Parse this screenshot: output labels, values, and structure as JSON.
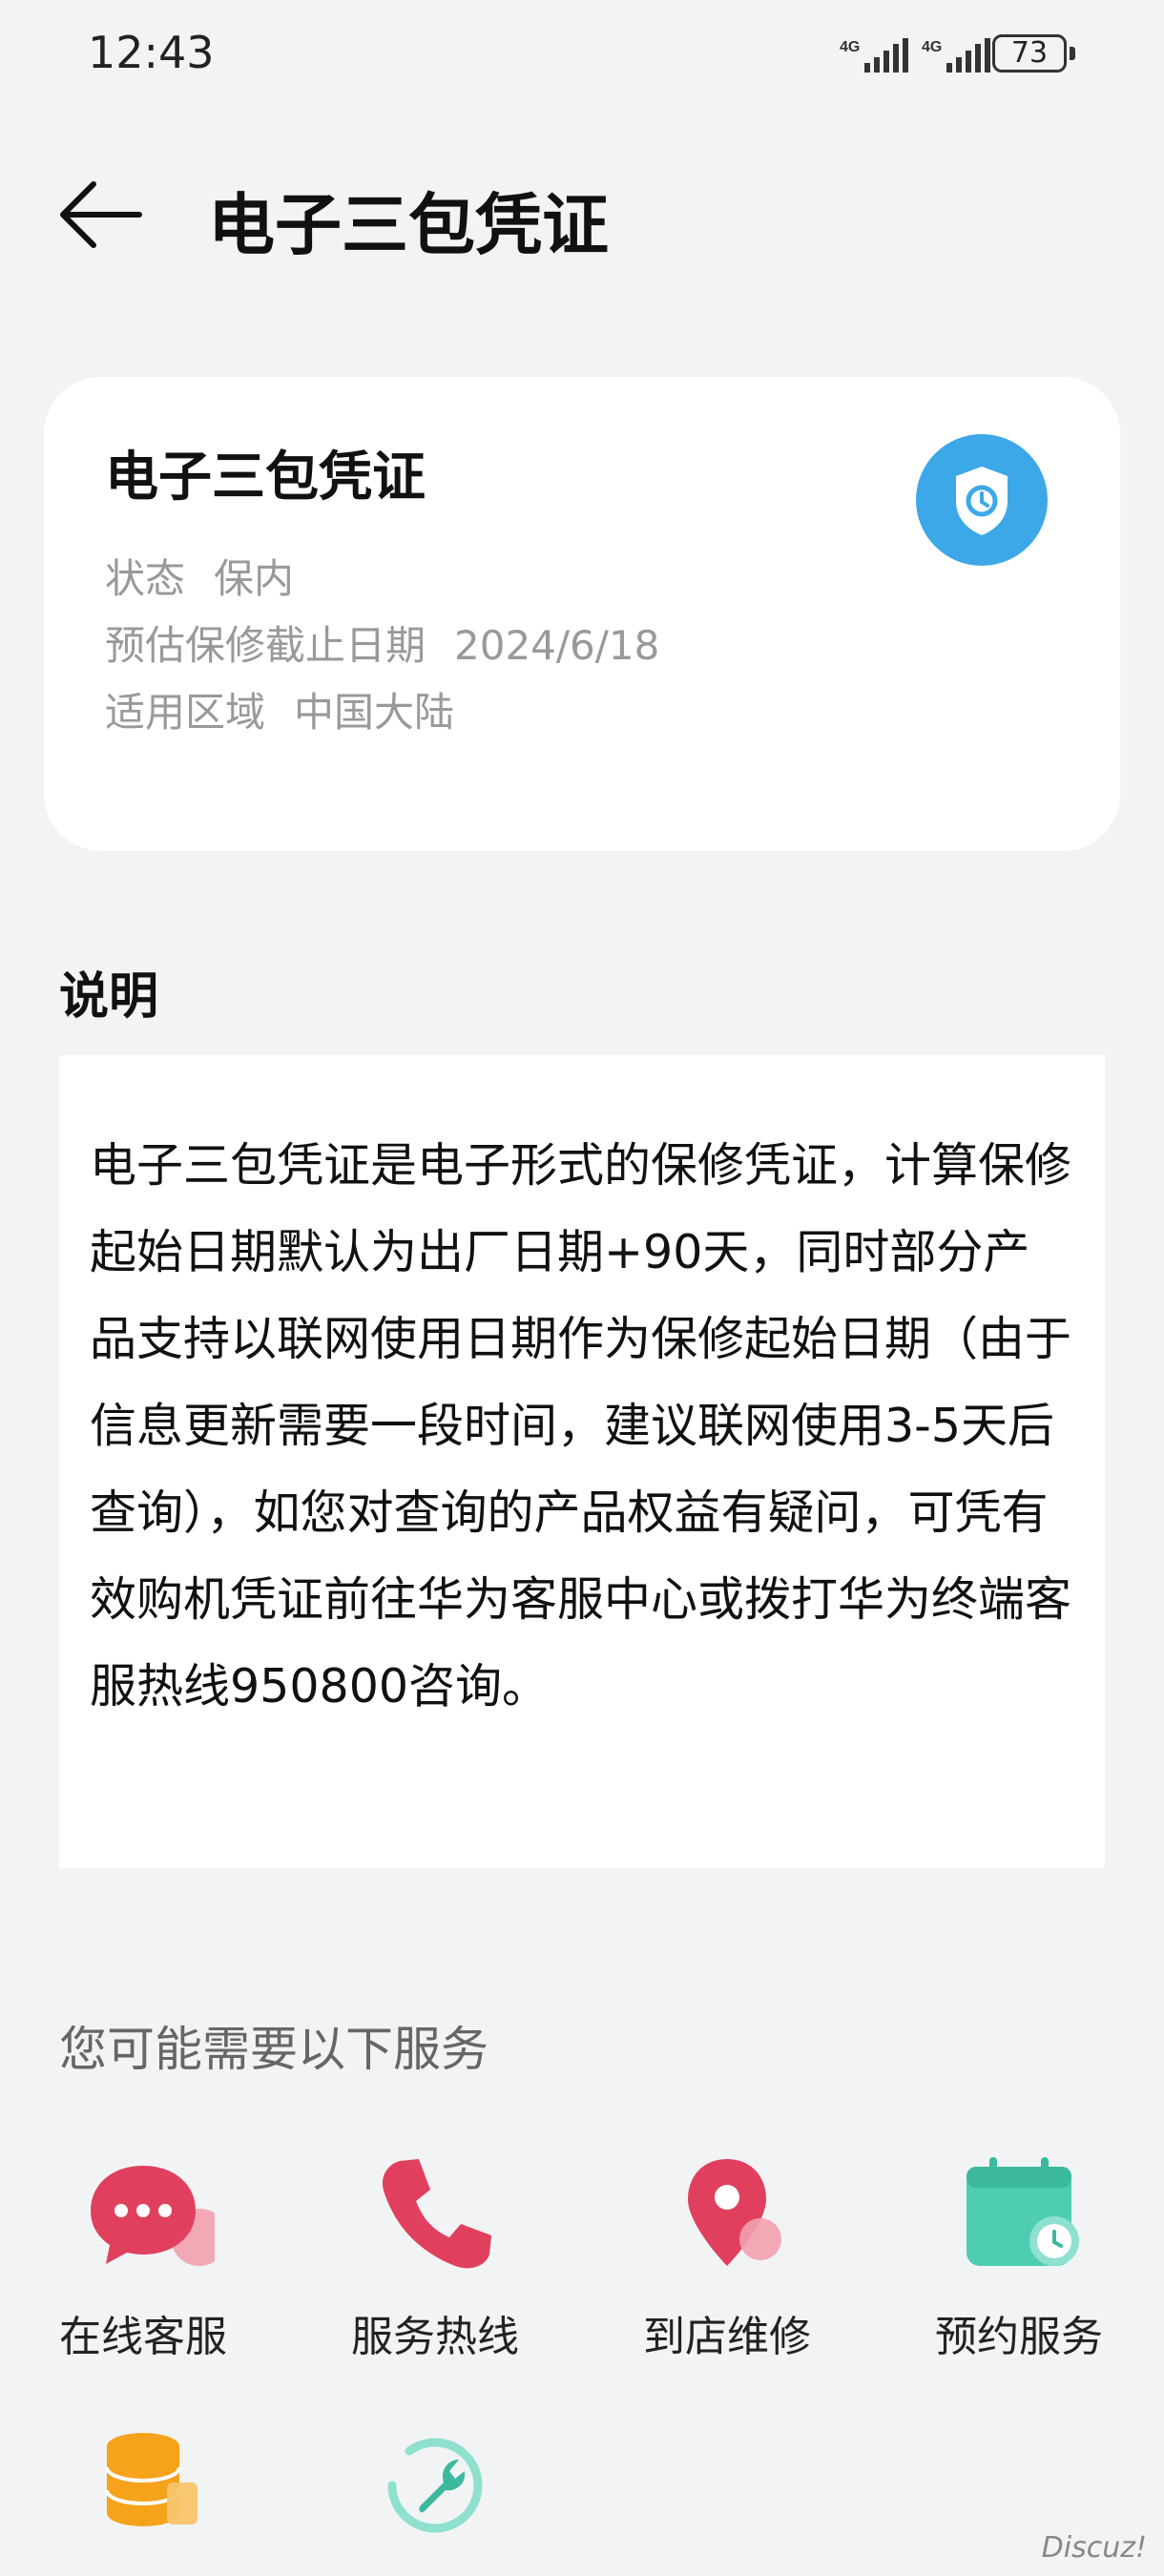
{
  "status_bar": {
    "time": "12:43",
    "network_1": "4G",
    "network_2": "4G",
    "battery": "73"
  },
  "header": {
    "title": "电子三包凭证"
  },
  "card": {
    "title": "电子三包凭证",
    "rows": [
      {
        "label": "状态",
        "value": "保内"
      },
      {
        "label": "预估保修截止日期",
        "value": "2024/6/18"
      },
      {
        "label": "适用区域",
        "value": "中国大陆"
      }
    ],
    "icon": "shield-clock-icon"
  },
  "description": {
    "title": "说明",
    "text": "电子三包凭证是电子形式的保修凭证，计算保修起始日期默认为出厂日期+90天，同时部分产品支持以联网使用日期作为保修起始日期（由于信息更新需要一段时间，建议联网使用3-5天后查询），如您对查询的产品权益有疑问，可凭有效购机凭证前往华为客服中心或拨打华为终端客服热线950800咨询。"
  },
  "services": {
    "title": "您可能需要以下服务",
    "items": [
      {
        "label": "在线客服",
        "icon": "chat-bubble-icon"
      },
      {
        "label": "服务热线",
        "icon": "phone-icon"
      },
      {
        "label": "到店维修",
        "icon": "location-pin-icon"
      },
      {
        "label": "预约服务",
        "icon": "calendar-clock-icon"
      },
      {
        "label": "",
        "icon": "coins-stack-icon"
      },
      {
        "label": "",
        "icon": "wrench-refresh-icon"
      }
    ]
  },
  "watermark": "Discuz!",
  "colors": {
    "background": "#f1f3f5",
    "shield_blue": "#3da8e8",
    "service_red": "#e0405e",
    "service_teal": "#4fcdb3",
    "service_orange": "#f6a21b"
  }
}
